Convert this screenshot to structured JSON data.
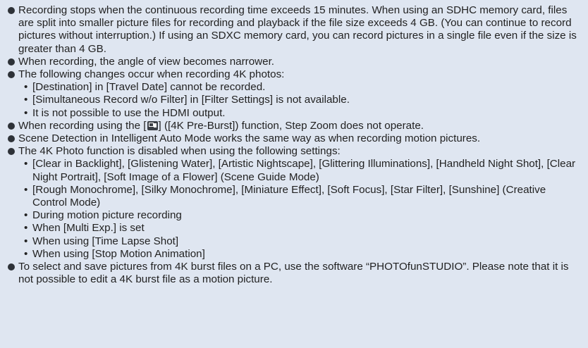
{
  "notes": {
    "i0": {
      "text": "Recording stops when the continuous recording time exceeds 15 minutes. When using an SDHC memory card, files are split into smaller picture files for recording and playback if the file size exceeds 4 GB. (You can continue to record pictures without interruption.) If using an SDXC memory card, you can record pictures in a single file even if the size is greater than 4 GB."
    },
    "i1": {
      "text": "When recording, the angle of view becomes narrower."
    },
    "i2": {
      "text": "The following changes occur when recording 4K photos:",
      "sub": [
        "[Destination] in [Travel Date] cannot be recorded.",
        "[Simultaneous Record w/o Filter] in [Filter Settings] is not available.",
        "It is not possible to use the HDMI output."
      ]
    },
    "i3": {
      "before": "When recording using the [",
      "icon": "4k-pre-burst-icon",
      "after": "] ([4K Pre-Burst]) function, Step Zoom does not operate."
    },
    "i4": {
      "text": "Scene Detection in Intelligent Auto Mode works the same way as when recording motion pictures."
    },
    "i5": {
      "text": "The 4K Photo function is disabled when using the following settings:",
      "sub": [
        "[Clear in Backlight], [Glistening Water], [Artistic Nightscape], [Glittering Illuminations], [Handheld Night Shot], [Clear Night Portrait], [Soft Image of a Flower] (Scene Guide Mode)",
        "[Rough Monochrome], [Silky Monochrome], [Miniature Effect], [Soft Focus], [Star Filter], [Sunshine] (Creative Control Mode)",
        "During motion picture recording",
        "When [Multi Exp.] is set",
        "When using [Time Lapse Shot]",
        "When using [Stop Motion Animation]"
      ]
    },
    "i6": {
      "text": "To select and save pictures from 4K burst files on a PC, use the software “PHOTOfunSTUDIO”. Please note that it is not possible to edit a 4K burst file as a motion picture."
    },
    "sub_marker": "•"
  }
}
